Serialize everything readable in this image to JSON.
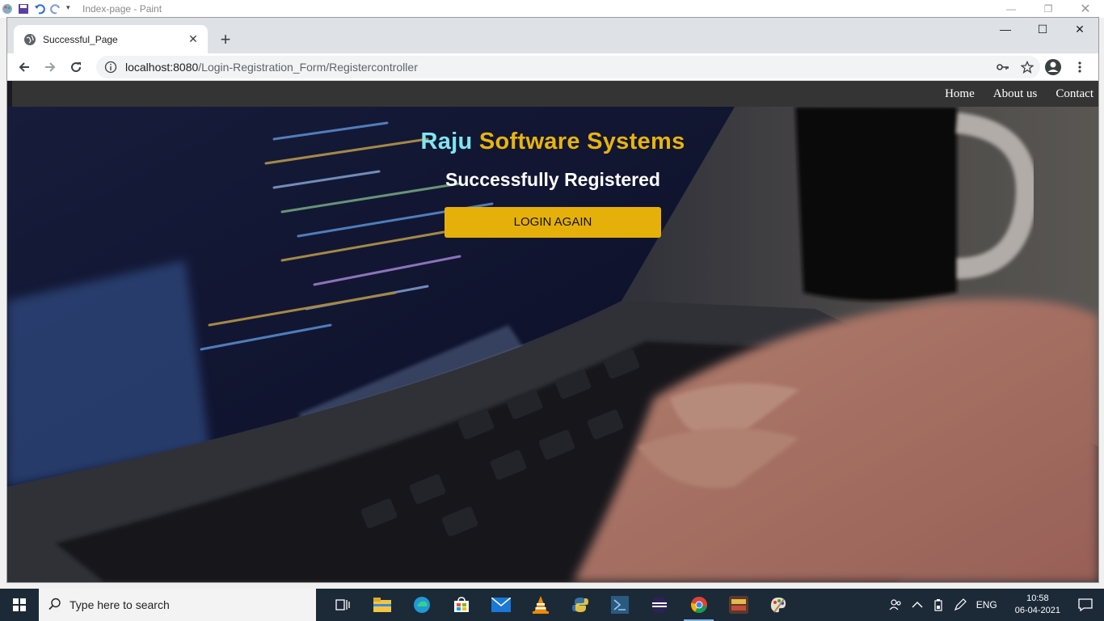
{
  "paint": {
    "title": "Index-page - Paint"
  },
  "browser": {
    "tab_title": "Successful_Page",
    "url_host": "localhost:8080",
    "url_path": "/Login-Registration_Form/Registercontroller"
  },
  "page": {
    "nav": [
      "Home",
      "About us",
      "Contact"
    ],
    "brand_part1": "Raju",
    "brand_part2": " Software Systems",
    "status": "Successfully Registered",
    "button": "LOGIN AGAIN",
    "colors": {
      "brand_part1": "#7fe6f0",
      "brand_part2": "#e9b40b",
      "button_bg": "#e6b00a",
      "navbar_bg": "#343434"
    }
  },
  "taskbar": {
    "search_placeholder": "Type here to search",
    "apps": [
      "task-view-icon",
      "file-explorer-icon",
      "edge-icon",
      "store-icon",
      "mail-icon",
      "vlc-icon",
      "python-icon",
      "vscode-icon",
      "eclipse-icon",
      "chrome-icon",
      "jobs-app-icon",
      "paint-icon"
    ],
    "language": "ENG",
    "time": "10:58",
    "date": "06-04-2021"
  }
}
